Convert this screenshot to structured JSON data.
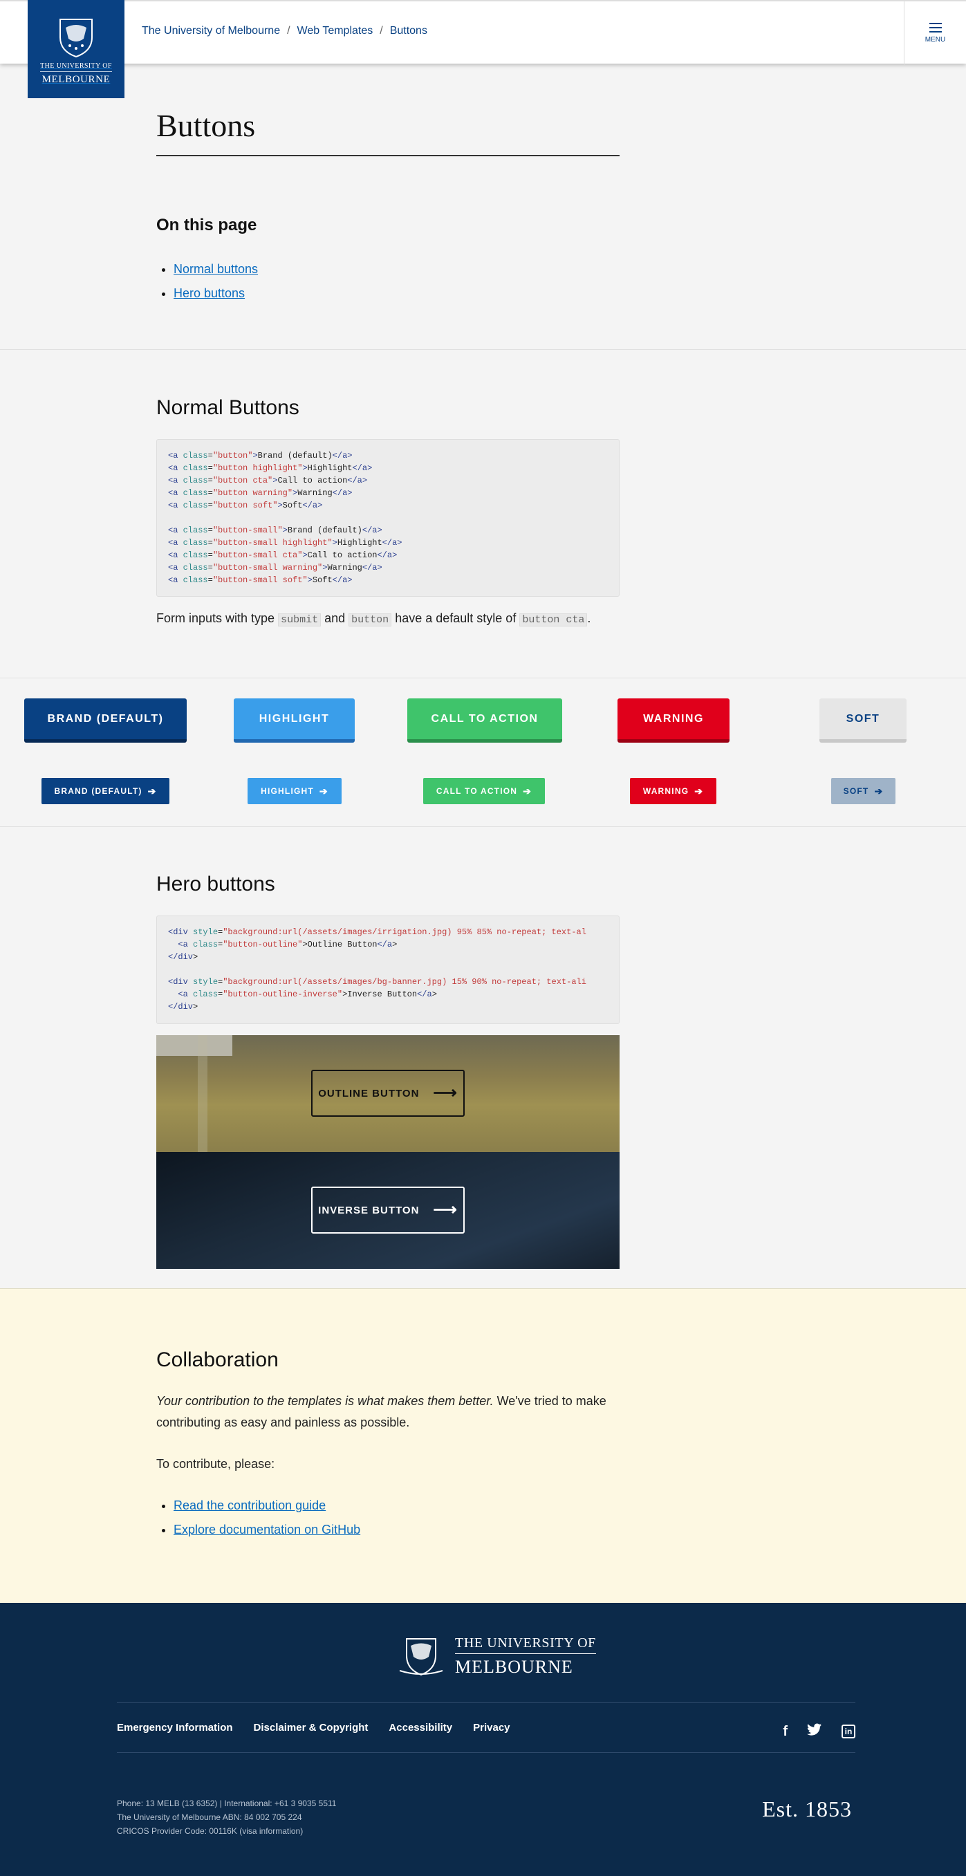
{
  "header": {
    "logo_line1": "THE UNIVERSITY OF",
    "logo_line2": "MELBOURNE",
    "breadcrumb": [
      "The University of Melbourne",
      "Web Templates",
      "Buttons"
    ],
    "breadcrumb_sep": "/",
    "menu_label": "MENU"
  },
  "page": {
    "title": "Buttons",
    "on_this_page": "On this page",
    "toc": [
      "Normal buttons",
      "Hero buttons"
    ]
  },
  "normal": {
    "title": "Normal Buttons",
    "code": [
      {
        "cls": "button",
        "text": "Brand (default)"
      },
      {
        "cls": "button highlight",
        "text": "Highlight"
      },
      {
        "cls": "button cta",
        "text": "Call to action"
      },
      {
        "cls": "button warning",
        "text": "Warning"
      },
      {
        "cls": "button soft",
        "text": "Soft"
      }
    ],
    "code_small": [
      {
        "cls": "button-small",
        "text": "Brand (default)"
      },
      {
        "cls": "button-small highlight",
        "text": "Highlight"
      },
      {
        "cls": "button-small cta",
        "text": "Call to action"
      },
      {
        "cls": "button-small warning",
        "text": "Warning"
      },
      {
        "cls": "button-small soft",
        "text": "Soft"
      }
    ],
    "note_pre": "Form inputs with type",
    "note_code1": "submit",
    "note_and": "and",
    "note_code2": "button",
    "note_mid": "have a default style of",
    "note_code3": "button cta",
    "note_end": "."
  },
  "demo_buttons": {
    "large": [
      "BRAND (DEFAULT)",
      "HIGHLIGHT",
      "CALL TO ACTION",
      "WARNING",
      "SOFT"
    ],
    "small": [
      "BRAND (DEFAULT)",
      "HIGHLIGHT",
      "CALL TO ACTION",
      "WARNING",
      "SOFT"
    ],
    "colors": {
      "brand": "#094183",
      "highlight": "#3a9eea",
      "cta": "#3fc46b",
      "warning": "#e0001b",
      "soft": "#e6e6e6"
    }
  },
  "hero": {
    "title": "Hero buttons",
    "code1_line1": "<div style=\"background:url(/assets/images/irrigation.jpg) 95% 85% no-repeat; text-al",
    "code1_line2": "  <a class=\"button-outline\">Outline Button</a>",
    "code1_line3": "</div>",
    "code2_line1": "<div style=\"background:url(/assets/images/bg-banner.jpg) 15% 90% no-repeat; text-ali",
    "code2_line2": "  <a class=\"button-outline-inverse\">Inverse Button</a>",
    "code2_line3": "</div>",
    "outline_label": "OUTLINE BUTTON",
    "inverse_label": "INVERSE BUTTON"
  },
  "collab": {
    "title": "Collaboration",
    "para_em": "Your contribution to the templates is what makes them better.",
    "para_rest": " We've tried to make contributing as easy and painless as possible.",
    "contribute": "To contribute, please:",
    "links": [
      "Read the contribution guide",
      "Explore documentation on GitHub"
    ]
  },
  "footer": {
    "logo_line1": "THE UNIVERSITY OF",
    "logo_line2": "MELBOURNE",
    "links": [
      "Emergency Information",
      "Disclaimer & Copyright",
      "Accessibility",
      "Privacy"
    ],
    "social_icons": [
      "facebook-icon",
      "twitter-icon",
      "linkedin-icon"
    ],
    "info": [
      "Phone: 13 MELB (13 6352) | International: +61 3 9035 5511",
      "The University of Melbourne ABN: 84 002 705 224",
      "CRICOS Provider Code: 00116K (visa information)"
    ],
    "est": "Est. 1853"
  }
}
